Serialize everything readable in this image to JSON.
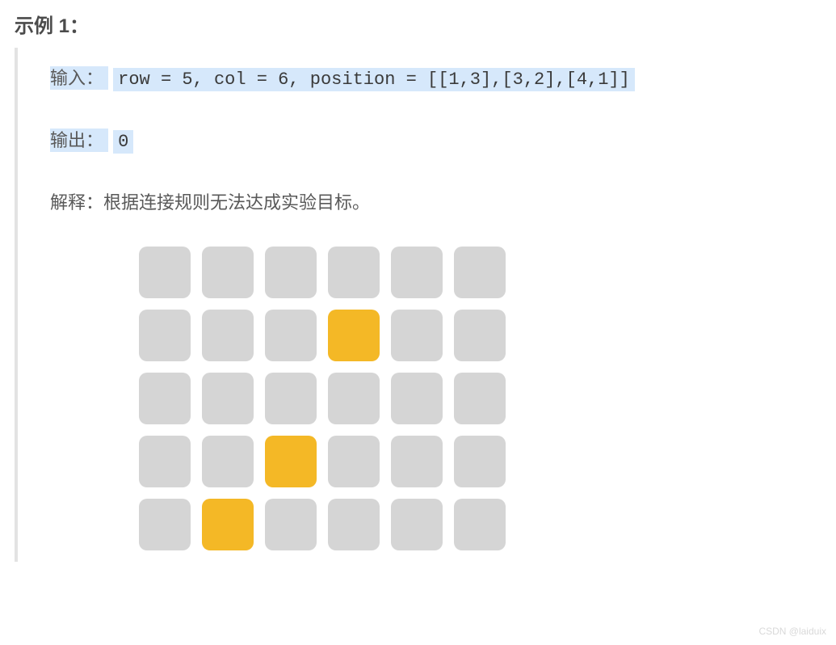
{
  "heading": "示例 1：",
  "io": {
    "input_label": "输入：",
    "input_value": "row = 5, col = 6, position = [[1,3],[3,2],[4,1]]",
    "output_label": "输出：",
    "output_value": "0"
  },
  "explain": {
    "label": "解释：",
    "text": "根据连接规则无法达成实验目标。"
  },
  "grid": {
    "rows": 5,
    "cols": 6,
    "active_positions": [
      [
        1,
        3
      ],
      [
        3,
        2
      ],
      [
        4,
        1
      ]
    ],
    "colors": {
      "inactive": "#d5d5d5",
      "active": "#f4b826"
    }
  },
  "watermark": "CSDN @laiduix"
}
